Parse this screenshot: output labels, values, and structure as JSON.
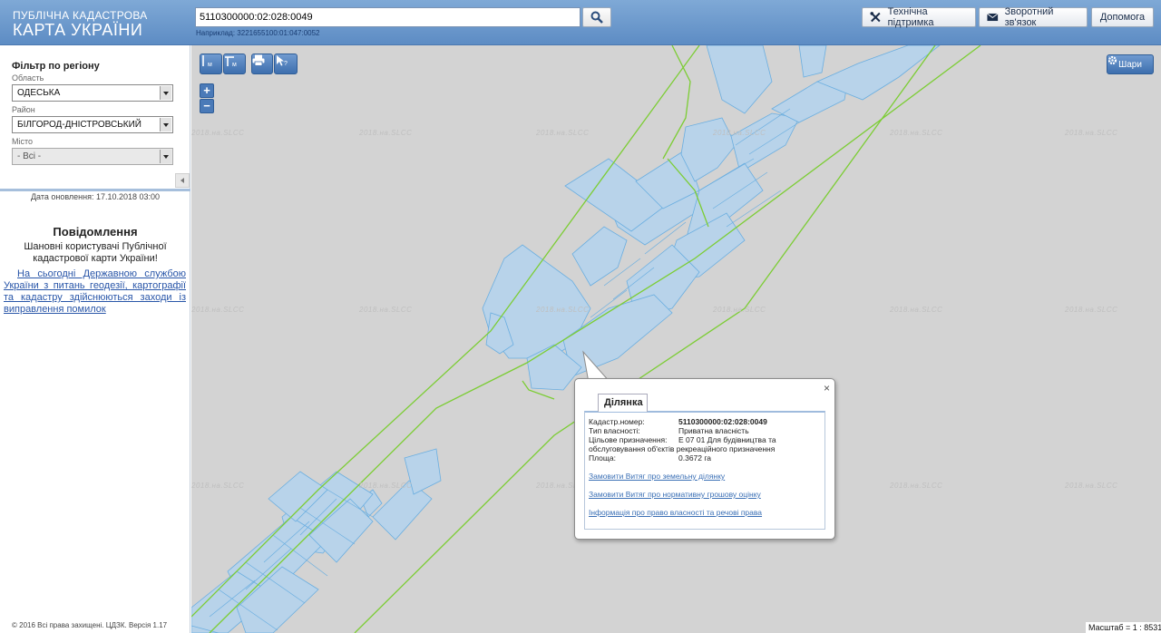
{
  "header": {
    "brand_line1": "ПУБЛІЧНА КАДАСТРОВА",
    "brand_line2": "КАРТА УКРАЇНИ",
    "search_value": "5110300000:02:028:0049",
    "search_hint": "Наприклад: 3221655100:01:047:0052",
    "buttons": {
      "support": "Технічна підтримка",
      "feedback": "Зворотний зв'язок",
      "help": "Допомога"
    }
  },
  "sidebar": {
    "filter_title": "Фільтр по регіону",
    "oblast_label": "Область",
    "oblast_value": "ОДЕСЬКА",
    "raion_label": "Район",
    "raion_value": "БІЛГОРОД-ДНІСТРОВСЬКИЙ",
    "misto_label": "Місто",
    "misto_value": "- Всі -",
    "updated": "Дата оновлення: 17.10.2018 03:00",
    "notice_title": "Повідомлення",
    "notice_text": "Шановні користувачі Публічної кадастрової карти України!",
    "notice_link": "На сьогодні Державною службою України з питань геодезії, картографії та кадастру здійснюються заходи із виправлення помилок",
    "copyright": "© 2016 Всі права захищені. ЦДЗК. Версія 1.17"
  },
  "map": {
    "watermark": "2018.на.SLCC",
    "layers_label": "Шари",
    "zoom_in": "+",
    "zoom_out": "−",
    "scale": "Масштаб = 1 : 8531",
    "colors": {
      "background": "#d3d3d3",
      "parcel_fill": "#b8d3ea",
      "parcel_stroke": "#6aaee0",
      "boundary": "#7ccd34"
    }
  },
  "popup": {
    "tab": "Ділянка",
    "close": "×",
    "rows": [
      {
        "k": "Кадастр.номер:",
        "v": "5110300000:02:028:0049",
        "bold": true
      },
      {
        "k": "Тип власності:",
        "v": "Приватна власність"
      },
      {
        "k": "Цільове призначення:",
        "v": "Е 07 01 Для будівництва та обслуговування об'єктів рекреаційного призначення"
      },
      {
        "k": "Площа:",
        "v": "0.3672 га"
      }
    ],
    "links": [
      "Замовити Витяг про земельну ділянку",
      "Замовити Витяг про нормативну грошову оцінку",
      "Інформація про право власності та речові права"
    ]
  }
}
